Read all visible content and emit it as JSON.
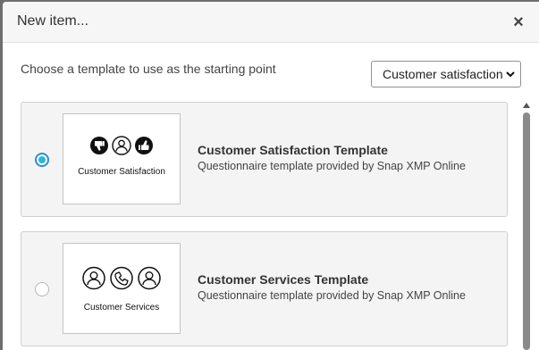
{
  "dialog": {
    "title": "New item...",
    "close_label": "×"
  },
  "prompt": "Choose a template to use as the starting point",
  "category_select": {
    "selected": "Customer satisfaction"
  },
  "templates": [
    {
      "title": "Customer Satisfaction Template",
      "description": "Questionnaire template provided by Snap XMP Online",
      "thumbnail_caption": "Customer Satisfaction",
      "selected": true
    },
    {
      "title": "Customer Services Template",
      "description": "Questionnaire template provided by Snap XMP Online",
      "thumbnail_caption": "Customer Services",
      "selected": false
    }
  ],
  "colors": {
    "radio_accent": "#29b6e0",
    "card_bg": "#f4f4f4",
    "header_bg": "#f6f6f6"
  }
}
